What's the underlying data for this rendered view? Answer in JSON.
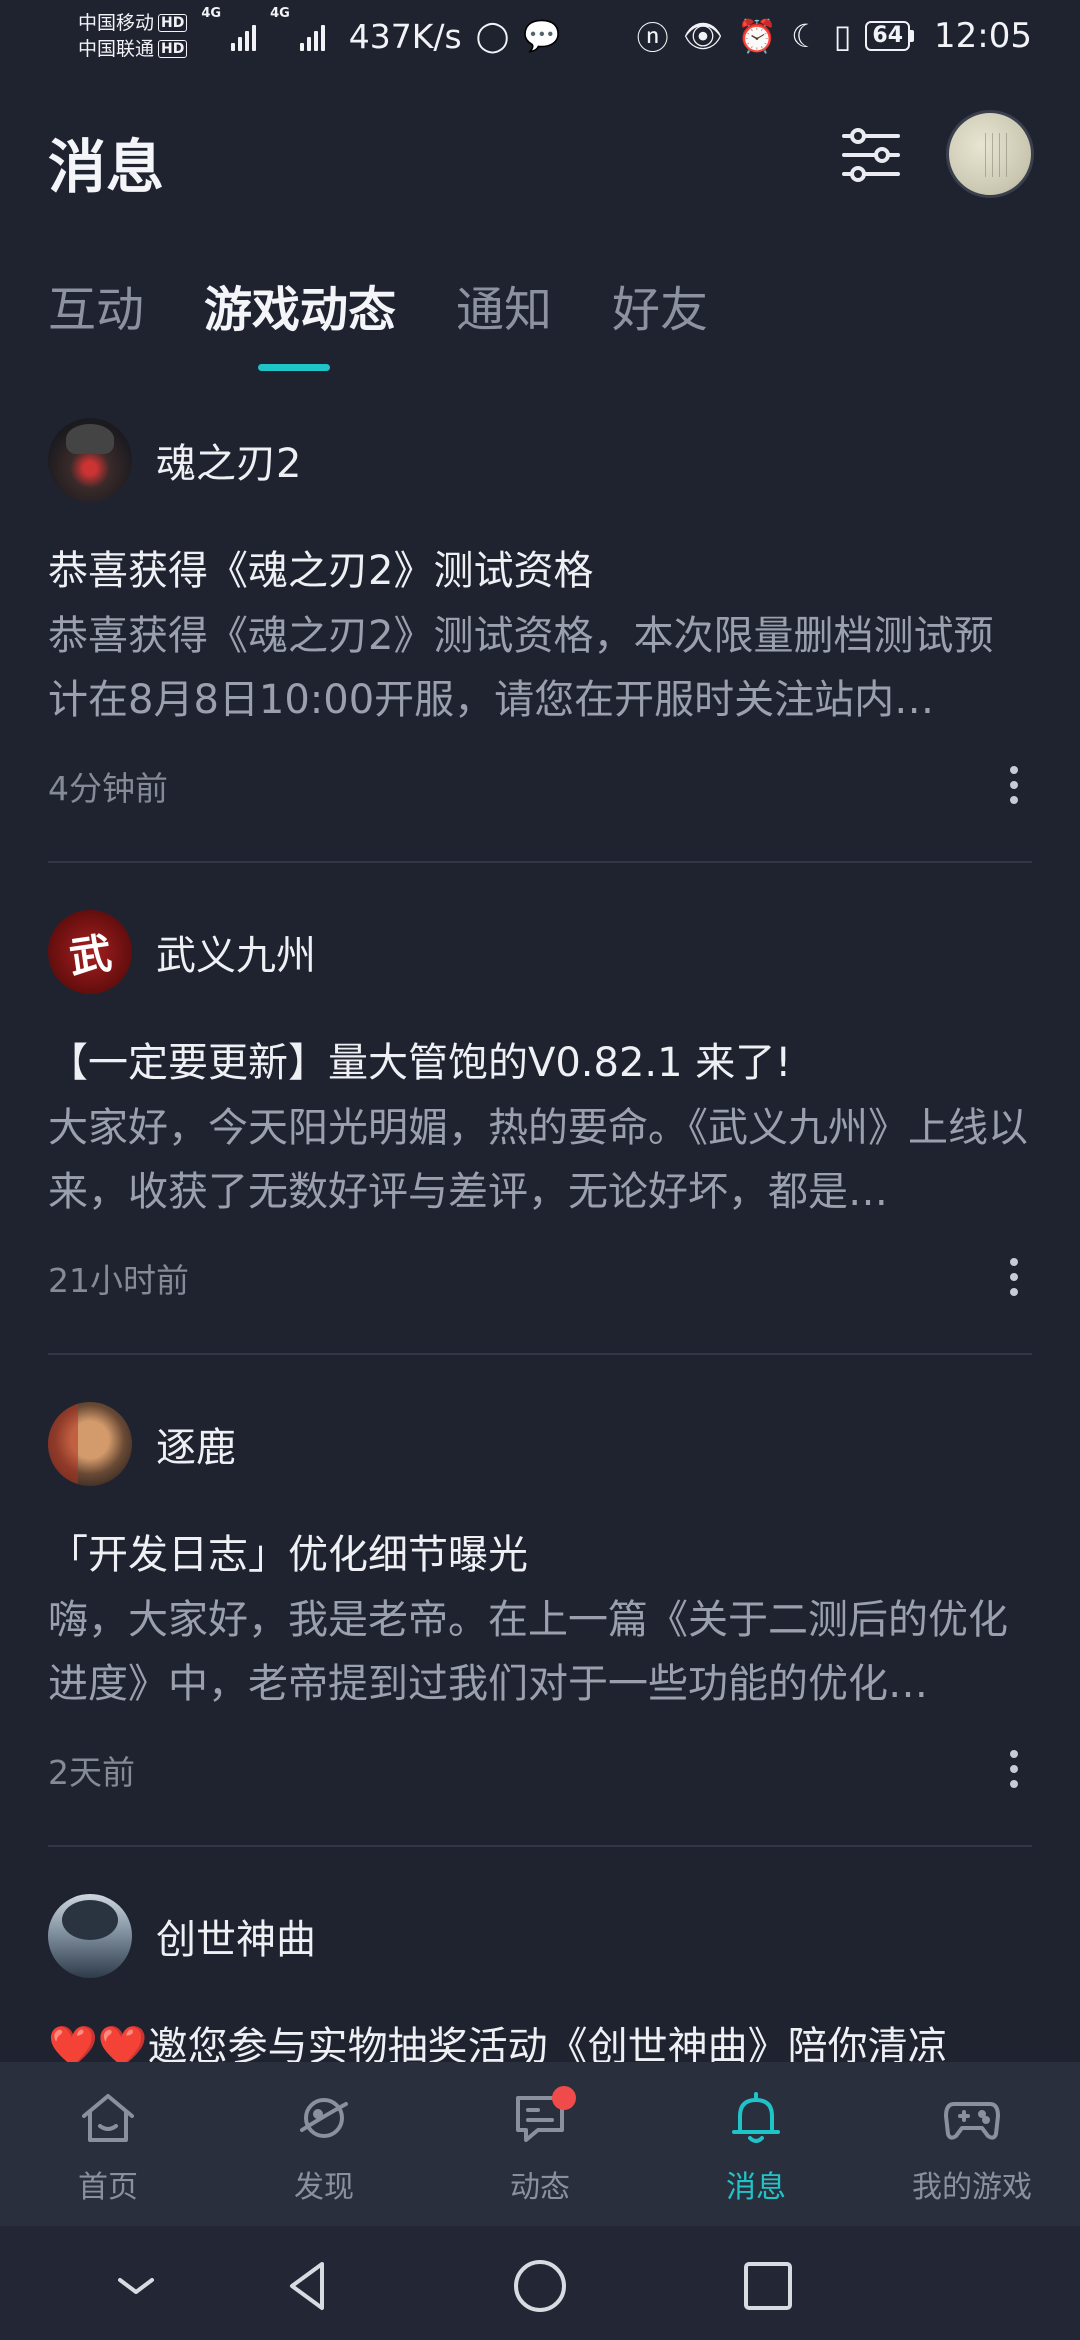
{
  "status_bar": {
    "carrier1": "中国移动",
    "carrier2": "中国联通",
    "hd": "HD",
    "signal_label1": "4G",
    "signal_label2": "4G",
    "net_speed": "437K/s",
    "battery": "64",
    "time": "12:05"
  },
  "header": {
    "title": "消息"
  },
  "tabs": [
    {
      "label": "互动"
    },
    {
      "label": "游戏动态"
    },
    {
      "label": "通知"
    },
    {
      "label": "好友"
    }
  ],
  "active_tab": "游戏动态",
  "feed": [
    {
      "game": "魂之刃2",
      "title": "恭喜获得《魂之刃2》测试资格",
      "body": "恭喜获得《魂之刃2》测试资格，本次限量删档测试预计在8月8日10:00开服，请您在开服时关注站内…",
      "time": "4分钟前"
    },
    {
      "game": "武义九州",
      "title": "【一定要更新】量大管饱的V0.82.1 来了!",
      "body": "大家好，今天阳光明媚，热的要命。《武义九州》上线以来，收获了无数好评与差评，无论好坏，都是…",
      "time": "21小时前",
      "avatar_glyph": "武"
    },
    {
      "game": "逐鹿",
      "title": "「开发日志」优化细节曝光",
      "body": "嗨，大家好，我是老帝。在上一篇《关于二测后的优化进度》中，老帝提到过我们对于一些功能的优化…",
      "time": "2天前"
    },
    {
      "game": "创世神曲",
      "title_hearts": "❤️❤️",
      "title": "邀您参与实物抽奖活动《创世神曲》陪你清凉"
    }
  ],
  "bottom_nav": [
    {
      "label": "首页",
      "icon": "home-icon"
    },
    {
      "label": "发现",
      "icon": "planet-icon"
    },
    {
      "label": "动态",
      "icon": "chat-icon",
      "badge": true
    },
    {
      "label": "消息",
      "icon": "bell-icon",
      "active": true
    },
    {
      "label": "我的游戏",
      "icon": "gamepad-icon"
    }
  ],
  "colors": {
    "background": "#1f2330",
    "accent": "#1fc4c9",
    "badge": "#f04b4b"
  }
}
